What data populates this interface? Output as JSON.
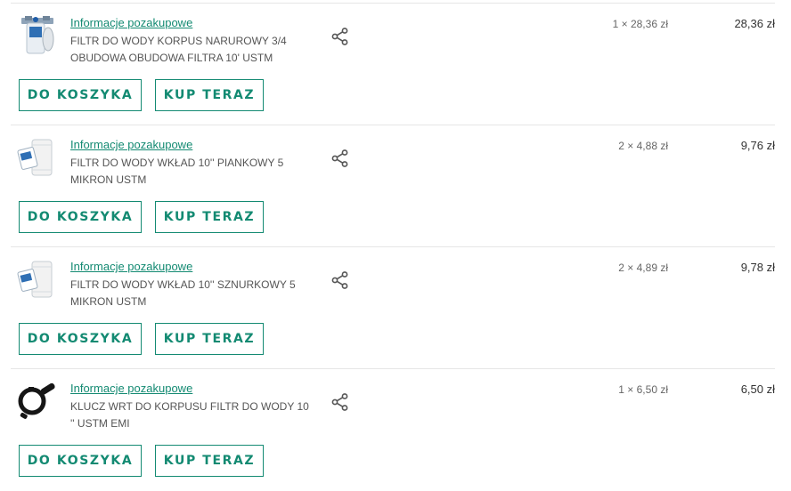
{
  "items": [
    {
      "image": "filter-housing-icon",
      "info_link": "Informacje pozakupowe",
      "name": "FILTR DO WODY KORPUS NARUROWY 3/4 OBUDOWA OBUDOWA FILTRA 10' USTM",
      "qty_price": "1 × 28,36 zł",
      "total": "28,36 zł",
      "cart_label": "DO KOSZYKA",
      "buy_label": "KUP TERAZ"
    },
    {
      "image": "filter-cartridge-icon",
      "info_link": "Informacje pozakupowe",
      "name": "FILTR DO WODY WKŁAD 10'' PIANKOWY 5 MIKRON USTM",
      "qty_price": "2 × 4,88 zł",
      "total": "9,76 zł",
      "cart_label": "DO KOSZYKA",
      "buy_label": "KUP TERAZ"
    },
    {
      "image": "filter-cartridge-icon",
      "info_link": "Informacje pozakupowe",
      "name": "FILTR DO WODY WKŁAD 10'' SZNURKOWY 5 MIKRON USTM",
      "qty_price": "2 × 4,89 zł",
      "total": "9,78 zł",
      "cart_label": "DO KOSZYKA",
      "buy_label": "KUP TERAZ"
    },
    {
      "image": "wrench-key-icon",
      "info_link": "Informacje pozakupowe",
      "name": "KLUCZ WRT DO KORPUSU FILTR DO WODY 10 '' USTM EMI",
      "qty_price": "1 × 6,50 zł",
      "total": "6,50 zł",
      "cart_label": "DO KOSZYKA",
      "buy_label": "KUP TERAZ"
    }
  ],
  "colors": {
    "accent": "#138a72",
    "separator": "#e6e6e6",
    "text": "#555555"
  }
}
